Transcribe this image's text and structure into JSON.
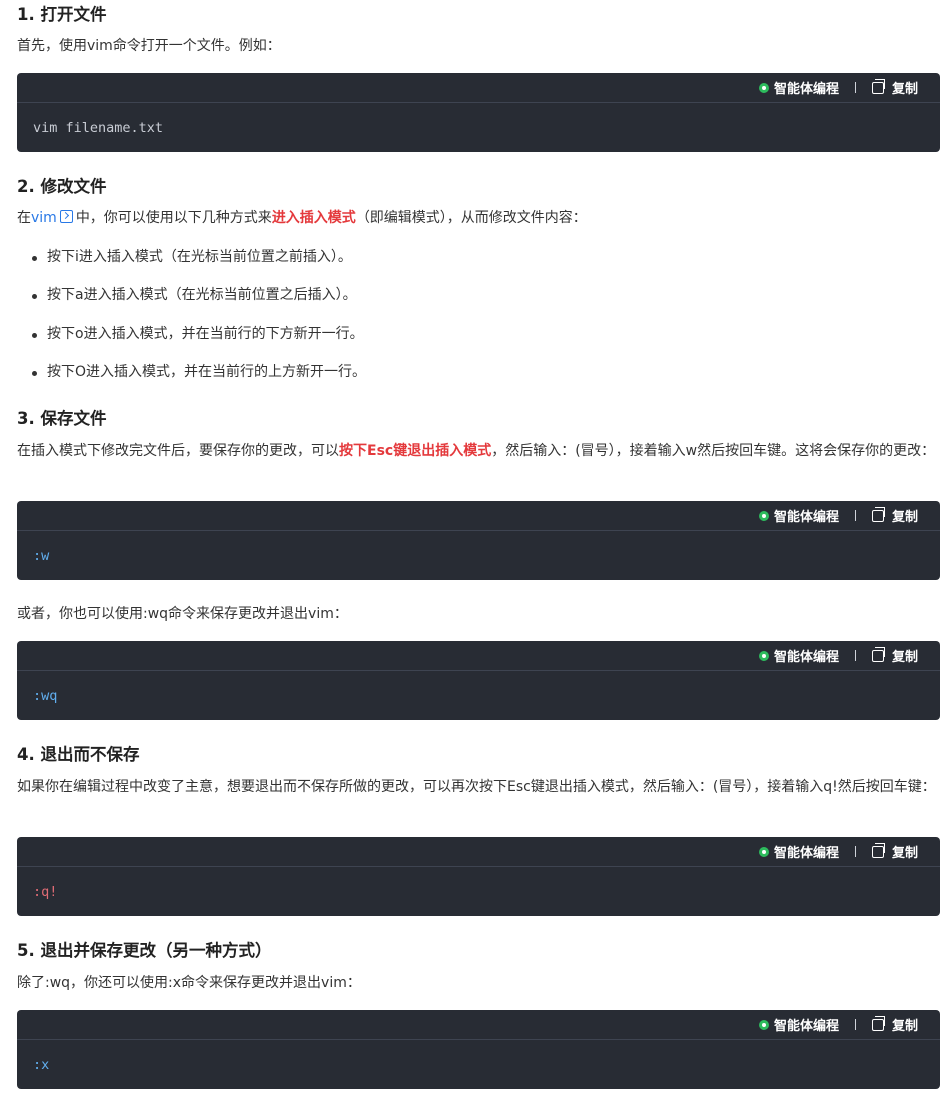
{
  "sections": [
    {
      "title": "1. 打开文件"
    },
    {
      "title": "2. 修改文件"
    },
    {
      "title": "3. 保存文件"
    },
    {
      "title": "4. 退出而不保存"
    },
    {
      "title": "5. 退出并保存更改（另一种方式）"
    }
  ],
  "s1": {
    "para": "首先，使用vim命令打开一个文件。例如："
  },
  "s2": {
    "para_before": "在",
    "link": "vim",
    "para_mid": "中，你可以使用以下几种方式来",
    "highlight": "进入插入模式",
    "para_after": "（即编辑模式），从而修改文件内容：",
    "items": [
      "按下i进入插入模式（在光标当前位置之前插入）。",
      "按下a进入插入模式（在光标当前位置之后插入）。",
      "按下o进入插入模式，并在当前行的下方新开一行。",
      "按下O进入插入模式，并在当前行的上方新开一行。"
    ]
  },
  "s3": {
    "para_before": "在插入模式下修改完文件后，要保存你的更改，可以",
    "highlight": "按下Esc键退出插入模式",
    "para_after": "，然后输入：(冒号），接着输入w然后按回车键。这将会保存你的更改：",
    "alt": "或者，你也可以使用:wq命令来保存更改并退出vim："
  },
  "s4": {
    "para": "如果你在编辑过程中改变了主意，想要退出而不保存所做的更改，可以再次按下Esc键退出插入模式，然后输入：(冒号），接着输入q!然后按回车键："
  },
  "s5": {
    "para": "除了:wq，你还可以使用:x命令来保存更改并退出vim："
  },
  "code_toolbar": {
    "agent_label": "智能体编程",
    "copy_label": "复制"
  },
  "code_blocks": [
    {
      "code": "vim filename.txt"
    },
    {
      "code": ":w"
    },
    {
      "code": ":wq"
    },
    {
      "code": ":q!"
    },
    {
      "code": ":x"
    }
  ],
  "colors": {
    "code_bg": "#282c34",
    "highlight_red": "#e4393c",
    "link_blue": "#2878e6",
    "code_blue": "#61afef",
    "code_red": "#e06c75",
    "agent_green": "#2dbb5d"
  }
}
